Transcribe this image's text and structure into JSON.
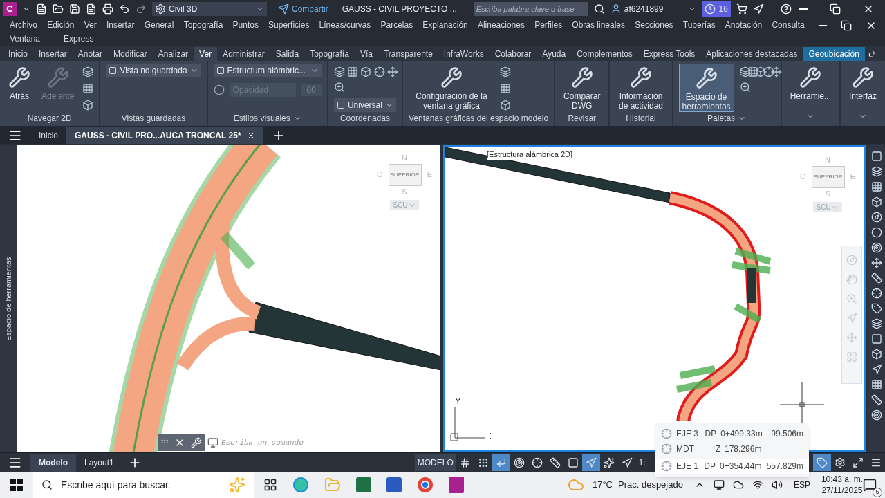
{
  "title_bar": {
    "app_letter": "C",
    "workspace": "Civil 3D",
    "share": "Compartir",
    "title": "GAUSS - CIVIL PROYECTO ...",
    "search_placeholder": "Escriba palabra clave o frase",
    "user": "af6241899",
    "badge": "16"
  },
  "menu": [
    [
      "Archivo",
      "Edición",
      "Ver",
      "Insertar",
      "General",
      "Topografía",
      "Puntos",
      "Superficies",
      "Líneas/curvas",
      "Parcelas",
      "Explanación",
      "Alineaciones",
      "Perfiles",
      "Obras lineales",
      "Secciones",
      "Tuberías",
      "Anotación",
      "Consulta"
    ],
    [
      "Ventana",
      "Express"
    ]
  ],
  "ribbon_tabs": [
    {
      "label": "Inicio",
      "selected": false
    },
    {
      "label": "Insertar",
      "selected": false
    },
    {
      "label": "Anotar",
      "selected": false
    },
    {
      "label": "Modificar",
      "selected": false
    },
    {
      "label": "Analizar",
      "selected": false
    },
    {
      "label": "Ver",
      "selected": true
    },
    {
      "label": "Administrar",
      "selected": false
    },
    {
      "label": "Salida",
      "selected": false
    },
    {
      "label": "Topografía",
      "selected": false
    },
    {
      "label": "Vía",
      "selected": false
    },
    {
      "label": "Transparente",
      "selected": false
    },
    {
      "label": "InfraWorks",
      "selected": false
    },
    {
      "label": "Colaborar",
      "selected": false
    },
    {
      "label": "Ayuda",
      "selected": false
    },
    {
      "label": "Complementos",
      "selected": false
    },
    {
      "label": "Express Tools",
      "selected": false
    },
    {
      "label": "Aplicaciones destacadas",
      "selected": false
    },
    {
      "label": "Geoubicación",
      "selected": false,
      "highlight": true
    }
  ],
  "ribbon_panels": [
    {
      "title": "Navegar 2D",
      "items": [
        {
          "kind": "large",
          "label": "Atrás",
          "disabled": false
        },
        {
          "kind": "large",
          "label": "Adelante",
          "disabled": true
        },
        {
          "kind": "icon-column"
        }
      ]
    },
    {
      "title": "Vistas guardadas",
      "items": [
        {
          "kind": "dropdown",
          "value": "Vista no guardada"
        }
      ]
    },
    {
      "title": "Estilos visuales",
      "menu": true,
      "items": [
        {
          "kind": "dropdown",
          "value": "Estructura alámbric..."
        },
        {
          "kind": "field",
          "placeholder": "Opacidad",
          "value": "60"
        }
      ]
    },
    {
      "title": "Coordenadas",
      "items": [
        {
          "kind": "icon-grid"
        },
        {
          "kind": "dropdown",
          "value": "Universal"
        }
      ]
    },
    {
      "title": "Ventanas gráficas del espacio modelo",
      "items": [
        {
          "kind": "large",
          "label": "Configuración de la ventana gráfica",
          "disabled": false
        },
        {
          "kind": "icon-column"
        }
      ]
    },
    {
      "title": "Revisar",
      "items": [
        {
          "kind": "large",
          "label": "Comparar DWG",
          "disabled": false
        }
      ]
    },
    {
      "title": "Historial",
      "items": [
        {
          "kind": "large",
          "label": "Información de actividad",
          "disabled": false
        }
      ]
    },
    {
      "title": "Paletas",
      "menu": true,
      "items": [
        {
          "kind": "large",
          "label": "Espacio de herramientas",
          "disabled": false,
          "active": true
        },
        {
          "kind": "icon-grid"
        }
      ]
    },
    {
      "items": [
        {
          "kind": "large",
          "label": "Herramie...",
          "disabled": false
        }
      ]
    },
    {
      "items": [
        {
          "kind": "large",
          "label": "Interfaz",
          "disabled": false
        }
      ]
    }
  ],
  "file_tabs": [
    {
      "label": "Inicio",
      "selected": false
    },
    {
      "label": "GAUSS - CIVIL PRO...AUCA TRONCAL 25*",
      "selected": true
    }
  ],
  "palette_label": "Espacio de herramientas",
  "viewports": [
    {
      "active": false,
      "viewcube": {
        "n": "N",
        "w": "O",
        "e": "E",
        "s": "S",
        "face": "SUPERIOR",
        "ucs": "SCU"
      }
    },
    {
      "active": true,
      "label": "[Estructura alámbrica 2D]",
      "viewcube": {
        "n": "N",
        "w": "O",
        "e": "E",
        "s": "S",
        "face": "SUPERIOR",
        "ucs": "SCU"
      },
      "ucs_axis": "Y"
    }
  ],
  "command_line": {
    "placeholder": "Escriba un comando"
  },
  "layout_tabs": [
    {
      "label": "Modelo",
      "selected": true
    },
    {
      "label": "Layout1",
      "selected": false
    }
  ],
  "status_bar": {
    "space": "MODELO",
    "scale": "1:",
    "tools": [
      {
        "kind": "grid",
        "on": false
      },
      {
        "kind": "snap",
        "on": false
      },
      {
        "kind": "ortho",
        "on": true
      },
      {
        "kind": "polar",
        "on": false
      },
      {
        "kind": "osnap-track",
        "on": false
      },
      {
        "kind": "angle",
        "on": false
      },
      {
        "kind": "osnap",
        "on": false
      },
      {
        "kind": "annotation",
        "on": true
      },
      {
        "kind": "annotation-auto",
        "on": false
      },
      {
        "kind": "annotation-scale",
        "on": false
      }
    ],
    "right_tools": [
      {
        "kind": "tag",
        "on": true
      },
      {
        "kind": "workspace",
        "on": false
      },
      {
        "kind": "fullscreen",
        "on": false
      },
      {
        "kind": "customize",
        "on": false
      }
    ]
  },
  "tooltip": [
    {
      "name": "EJE 3",
      "param": "DP",
      "value": "0+499.33m",
      "offset": "-99.506m"
    },
    {
      "name": "MDT",
      "param": "Z",
      "value": "178.296m"
    },
    {
      "name": "EJE 1",
      "param": "DP",
      "value": "0+354.44m",
      "offset": "557.829m"
    }
  ],
  "taskbar": {
    "search_placeholder": "Escribe aquí para buscar.",
    "temperature": "17°C",
    "weather": "Prac. despejado",
    "language": "ESP",
    "time": "10:43 a. m.",
    "date": "27/11/2025",
    "notifications": "5"
  }
}
